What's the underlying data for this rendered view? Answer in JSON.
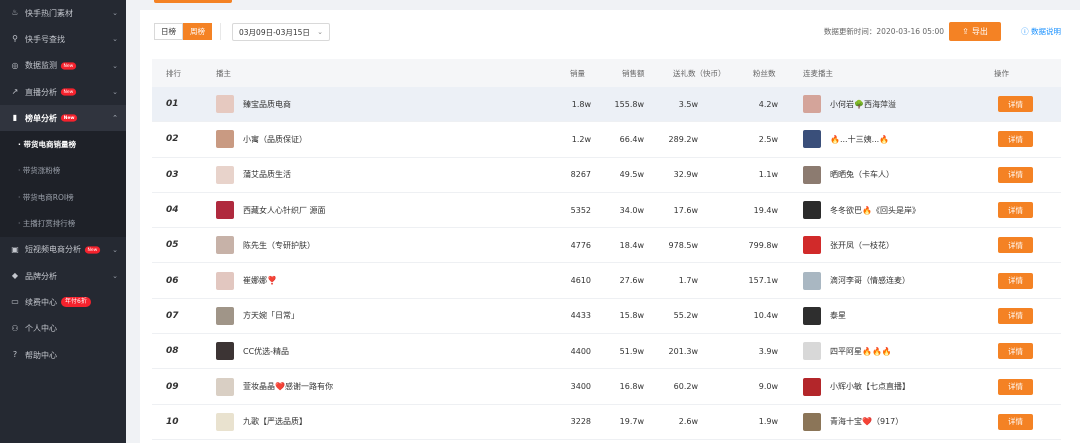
{
  "sidebar": {
    "items": [
      {
        "label": "快手热门素材",
        "icon": "fire-icon",
        "glyph": "♨",
        "chevron": "⌄"
      },
      {
        "label": "快手号查找",
        "icon": "search-icon",
        "glyph": "⚲",
        "chevron": "⌄"
      },
      {
        "label": "数据监测",
        "icon": "monitor-icon",
        "glyph": "◎",
        "badge": "New",
        "chevron": "⌄"
      },
      {
        "label": "直播分析",
        "icon": "trend-icon",
        "glyph": "↗",
        "badge": "New",
        "chevron": "⌄"
      },
      {
        "label": "榜单分析",
        "icon": "bar-chart-icon",
        "glyph": "▮",
        "badge": "New",
        "chevron": "⌃",
        "active": true
      }
    ],
    "sub_items": [
      {
        "label": "· 带货电商销量榜",
        "active": true
      },
      {
        "label": "· 带货涨粉榜"
      },
      {
        "label": "· 带货电商ROI榜"
      },
      {
        "label": "· 主播打赏排行榜"
      }
    ],
    "items2": [
      {
        "label": "短视频电商分析",
        "icon": "gift-icon",
        "glyph": "▣",
        "badge": "New",
        "chevron": "⌄"
      },
      {
        "label": "品牌分析",
        "icon": "diamond-icon",
        "glyph": "◆",
        "chevron": "⌄"
      },
      {
        "label": "续费中心",
        "icon": "card-icon",
        "glyph": "▭",
        "badge_year": "年付6折"
      },
      {
        "label": "个人中心",
        "icon": "user-icon",
        "glyph": "⚇"
      },
      {
        "label": "帮助中心",
        "icon": "help-icon",
        "glyph": "?"
      }
    ]
  },
  "toolbar": {
    "day_label": "日榜",
    "week_label": "周榜",
    "date_range": "03月09日-03月15日",
    "update_time": "数据更新时间：2020-03-16 05:00",
    "export_label": "导出",
    "data_desc": "数据说明"
  },
  "table": {
    "headers": {
      "rank": "排行",
      "anchor": "播主",
      "sales": "销量",
      "amount": "销售额",
      "gift": "送礼数（快币）",
      "fans": "粉丝数",
      "lianmai": "连麦播主",
      "op": "操作"
    },
    "rows": [
      {
        "rank": "01",
        "anchor": "臻宝品质电商",
        "sales": "1.8w",
        "amount": "155.8w",
        "gift": "3.5w",
        "fans": "4.2w",
        "lianmai": "小何岩🌳西海萍溢",
        "detail": "详情",
        "av": "#e6c9c0",
        "lav": "#d4a49a"
      },
      {
        "rank": "02",
        "anchor": "小寓（品质保证）",
        "sales": "1.2w",
        "amount": "66.4w",
        "gift": "289.2w",
        "fans": "2.5w",
        "lianmai": "🔥...十三姨...🔥",
        "detail": "详情",
        "av": "#c99a82",
        "lav": "#3a4f7a"
      },
      {
        "rank": "03",
        "anchor": "蒲艾品质生活",
        "sales": "8267",
        "amount": "49.5w",
        "gift": "32.9w",
        "fans": "1.1w",
        "lianmai": "晒晒兔（卡车人）",
        "detail": "详情",
        "av": "#e8d3cb",
        "lav": "#8c7b70"
      },
      {
        "rank": "04",
        "anchor": "西藏女人心针织厂 源面",
        "sales": "5352",
        "amount": "34.0w",
        "gift": "17.6w",
        "fans": "19.4w",
        "lianmai": "冬冬欲巴🔥《回头是岸》",
        "detail": "详情",
        "av": "#b02a3e",
        "lav": "#2b2b2b"
      },
      {
        "rank": "05",
        "anchor": "陈先生（专研护肤）",
        "sales": "4776",
        "amount": "18.4w",
        "gift": "978.5w",
        "fans": "799.8w",
        "lianmai": "张开凤（一枝花）",
        "detail": "详情",
        "av": "#c7b2a8",
        "lav": "#d12a2a"
      },
      {
        "rank": "06",
        "anchor": "崔娜娜❣️",
        "sales": "4610",
        "amount": "27.6w",
        "gift": "1.7w",
        "fans": "157.1w",
        "lianmai": "滴河李哥（情感连麦）",
        "detail": "详情",
        "av": "#e2c7c0",
        "lav": "#a9b7c2"
      },
      {
        "rank": "07",
        "anchor": "方天婉「日常」",
        "sales": "4433",
        "amount": "15.8w",
        "gift": "55.2w",
        "fans": "10.4w",
        "lianmai": "泰星",
        "detail": "详情",
        "av": "#a09588",
        "lav": "#2e2e2e"
      },
      {
        "rank": "08",
        "anchor": "CC优选-精品",
        "sales": "4400",
        "amount": "51.9w",
        "gift": "201.3w",
        "fans": "3.9w",
        "lianmai": "四平阿星🔥🔥🔥",
        "detail": "详情",
        "av": "#3c3434",
        "lav": "#d8d8d8"
      },
      {
        "rank": "09",
        "anchor": "萱妆晶晶❤️感谢一路有你",
        "sales": "3400",
        "amount": "16.8w",
        "gift": "60.2w",
        "fans": "9.0w",
        "lianmai": "小辉小敏【七点直播】",
        "detail": "详情",
        "av": "#d9cfc4",
        "lav": "#b3262a"
      },
      {
        "rank": "10",
        "anchor": "九歌【严选品质】",
        "sales": "3228",
        "amount": "19.7w",
        "gift": "2.6w",
        "fans": "1.9w",
        "lianmai": "青海十宝❤️（917）",
        "detail": "详情",
        "av": "#e9e2cf",
        "lav": "#8b7558"
      }
    ]
  }
}
